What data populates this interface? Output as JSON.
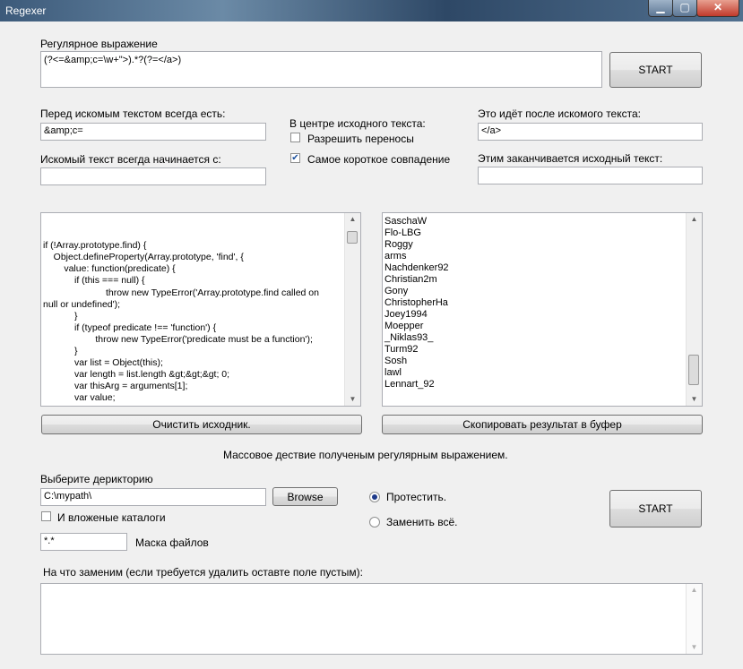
{
  "window": {
    "title": "Regexer",
    "min": "▁",
    "max": "▢",
    "close": "✕"
  },
  "regex": {
    "label": "Регулярное выражение",
    "value": "(?<=&amp;c=\\w+\">).*?(?=</a>)",
    "start": "START"
  },
  "before": {
    "label": "Перед искомым текстом всегда есть:",
    "value": "&amp;c="
  },
  "starts_with": {
    "label": "Искомый текст всегда начинается с:",
    "value": ""
  },
  "center": {
    "label": "В центре исходного текста:",
    "allow_wrap": {
      "label": "Разрешить переносы",
      "checked": false
    },
    "shortest": {
      "label": "Самое короткое совпадение",
      "checked": true
    }
  },
  "after": {
    "label": "Это идёт после искомого текста:",
    "value": "</a>"
  },
  "ends_with": {
    "label": "Этим заканчивается исходный текст:",
    "value": ""
  },
  "source_code": [
    "",
    "",
    "if (!Array.prototype.find) {",
    "    Object.defineProperty(Array.prototype, 'find', {",
    "        value: function(predicate) {",
    "            if (this === null) {",
    "                        throw new TypeError('Array.prototype.find called on",
    "null or undefined');",
    "            }",
    "            if (typeof predicate !== 'function') {",
    "                    throw new TypeError('predicate must be a function');",
    "            }",
    "            var list = Object(this);",
    "            var length = list.length &gt;&gt;&gt; 0;",
    "            var thisArg = arguments[1];",
    "            var value;"
  ],
  "results": [
    "SaschaW",
    "Flo-LBG",
    "Roggy",
    "arms",
    "Nachdenker92",
    "Christian2m",
    "Gony",
    "ChristopherHa",
    "Joey1994",
    "Moepper",
    "_Niklas93_",
    "Turm92",
    "Sosh",
    "lawl",
    "Lennart_92"
  ],
  "clear_button": "Очистить исходник.",
  "copy_button": "Скопировать результат в буфер",
  "mass_title": "Массовое дествие полученым регулярным выражением.",
  "directory": {
    "label": "Выберите дерикторию",
    "value": "C:\\mypath\\",
    "browse": "Browse"
  },
  "subdirs": {
    "label": "И вложеные каталоги",
    "checked": false
  },
  "mask": {
    "value": "*.*",
    "label": "Маска файлов"
  },
  "mode": {
    "test": "Протестить.",
    "replace_all": "Заменить всё.",
    "selected": "test"
  },
  "mass_start": "START",
  "replace": {
    "label": "На что заменим (если требуется удалить оставте поле пустым):",
    "value": ""
  }
}
